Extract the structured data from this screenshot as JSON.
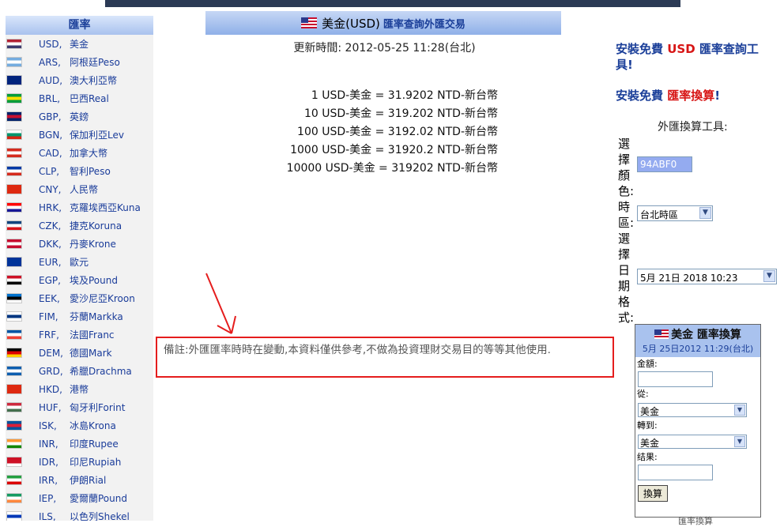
{
  "sidebar": {
    "title": "匯率",
    "items": [
      {
        "code": "USD,",
        "name": "美金",
        "flag": [
          "#b22234",
          "#ffffff",
          "#3c3b6e"
        ]
      },
      {
        "code": "ARS,",
        "name": "阿根廷Peso",
        "flag": [
          "#74acdf",
          "#ffffff",
          "#74acdf"
        ]
      },
      {
        "code": "AUD,",
        "name": "澳大利亞幣",
        "flag": [
          "#00247d",
          "#00247d",
          "#00247d"
        ]
      },
      {
        "code": "BRL,",
        "name": "巴西Real",
        "flag": [
          "#009c3b",
          "#ffdf00",
          "#009c3b"
        ]
      },
      {
        "code": "GBP,",
        "name": "英鎊",
        "flag": [
          "#012169",
          "#c8102e",
          "#012169"
        ]
      },
      {
        "code": "BGN,",
        "name": "保加利亞Lev",
        "flag": [
          "#ffffff",
          "#00966e",
          "#d62612"
        ]
      },
      {
        "code": "CAD,",
        "name": "加拿大幣",
        "flag": [
          "#d52b1e",
          "#ffffff",
          "#d52b1e"
        ]
      },
      {
        "code": "CLP,",
        "name": "智利Peso",
        "flag": [
          "#0039a6",
          "#ffffff",
          "#d52b1e"
        ]
      },
      {
        "code": "CNY,",
        "name": "人民幣",
        "flag": [
          "#de2910",
          "#de2910",
          "#de2910"
        ]
      },
      {
        "code": "HRK,",
        "name": "克羅埃西亞Kuna",
        "flag": [
          "#ff0000",
          "#ffffff",
          "#171796"
        ]
      },
      {
        "code": "CZK,",
        "name": "捷克Koruna",
        "flag": [
          "#11457e",
          "#ffffff",
          "#d7141a"
        ]
      },
      {
        "code": "DKK,",
        "name": "丹麥Krone",
        "flag": [
          "#c60c30",
          "#ffffff",
          "#c60c30"
        ]
      },
      {
        "code": "EUR,",
        "name": "歐元",
        "flag": [
          "#003399",
          "#003399",
          "#003399"
        ]
      },
      {
        "code": "EGP,",
        "name": "埃及Pound",
        "flag": [
          "#ce1126",
          "#ffffff",
          "#000000"
        ]
      },
      {
        "code": "EEK,",
        "name": "愛沙尼亞Kroon",
        "flag": [
          "#0072ce",
          "#000000",
          "#ffffff"
        ]
      },
      {
        "code": "FIM,",
        "name": "芬蘭Markka",
        "flag": [
          "#ffffff",
          "#003580",
          "#ffffff"
        ]
      },
      {
        "code": "FRF,",
        "name": "法國Franc",
        "flag": [
          "#0055a4",
          "#ffffff",
          "#ef4135"
        ]
      },
      {
        "code": "DEM,",
        "name": "德國Mark",
        "flag": [
          "#000000",
          "#dd0000",
          "#ffce00"
        ]
      },
      {
        "code": "GRD,",
        "name": "希臘Drachma",
        "flag": [
          "#0d5eaf",
          "#ffffff",
          "#0d5eaf"
        ]
      },
      {
        "code": "HKD,",
        "name": "港幣",
        "flag": [
          "#de2910",
          "#de2910",
          "#de2910"
        ]
      },
      {
        "code": "HUF,",
        "name": "匈牙利Forint",
        "flag": [
          "#cd2a3e",
          "#ffffff",
          "#436f4d"
        ]
      },
      {
        "code": "ISK,",
        "name": "冰島Krona",
        "flag": [
          "#02529c",
          "#dc1e35",
          "#02529c"
        ]
      },
      {
        "code": "INR,",
        "name": "印度Rupee",
        "flag": [
          "#ff9933",
          "#ffffff",
          "#138808"
        ]
      },
      {
        "code": "IDR,",
        "name": "印尼Rupiah",
        "flag": [
          "#ce1126",
          "#ce1126",
          "#ffffff"
        ]
      },
      {
        "code": "IRR,",
        "name": "伊朗Rial",
        "flag": [
          "#239f40",
          "#ffffff",
          "#da0000"
        ]
      },
      {
        "code": "IEP,",
        "name": "愛爾蘭Pound",
        "flag": [
          "#169b62",
          "#ffffff",
          "#ff883e"
        ]
      },
      {
        "code": "ILS,",
        "name": "以色列Shekel",
        "flag": [
          "#ffffff",
          "#0038b8",
          "#ffffff"
        ]
      }
    ]
  },
  "main": {
    "title_currency": "美金(USD)",
    "title_suffix": "匯率查詢外匯交易",
    "update_label": "更新時間: 2012-05-25 11:28(台北)",
    "rates": [
      "1 USD-美金 = 31.9202 NTD-新台幣",
      "10 USD-美金 = 319.202 NTD-新台幣",
      "100 USD-美金 = 3192.02 NTD-新台幣",
      "1000 USD-美金 = 31920.2 NTD-新台幣",
      "10000 USD-美金 =  319202 NTD-新台幣"
    ],
    "note": "備註:外匯匯率時時在變動,本資料僅供參考,不做為投資理財交易目的等等其他使用."
  },
  "right": {
    "promo1_a": "安裝免費 ",
    "promo1_b": "USD",
    "promo1_c": " 匯率查詢工具!",
    "promo2_a": "安裝免費 ",
    "promo2_b": "匯率換算",
    "promo2_c": "!",
    "tool_title": "外匯換算工具:",
    "label_color": "選擇顏色:",
    "color_value": "94ABF0",
    "label_timezone": "時區:",
    "timezone_value": "台北時區",
    "label_date_format": "選擇日期格式:",
    "date_format_value": "5月 21日 2018 10:23"
  },
  "widget": {
    "title": "美金 匯率換算",
    "date": "5月 25日2012 11:29(台北)",
    "amount_label": "金額:",
    "from_label": "從:",
    "from_value": "美金",
    "to_label": "轉到:",
    "to_value": "美金",
    "result_label": "结果:",
    "button_label": "換算",
    "footer_cut": "匯率換算"
  },
  "colors": {
    "accent_blue": "#1b3f99",
    "header_grad": "#a9c2ee",
    "note_border": "#e51d1d",
    "arrow": "#e51d1d"
  }
}
